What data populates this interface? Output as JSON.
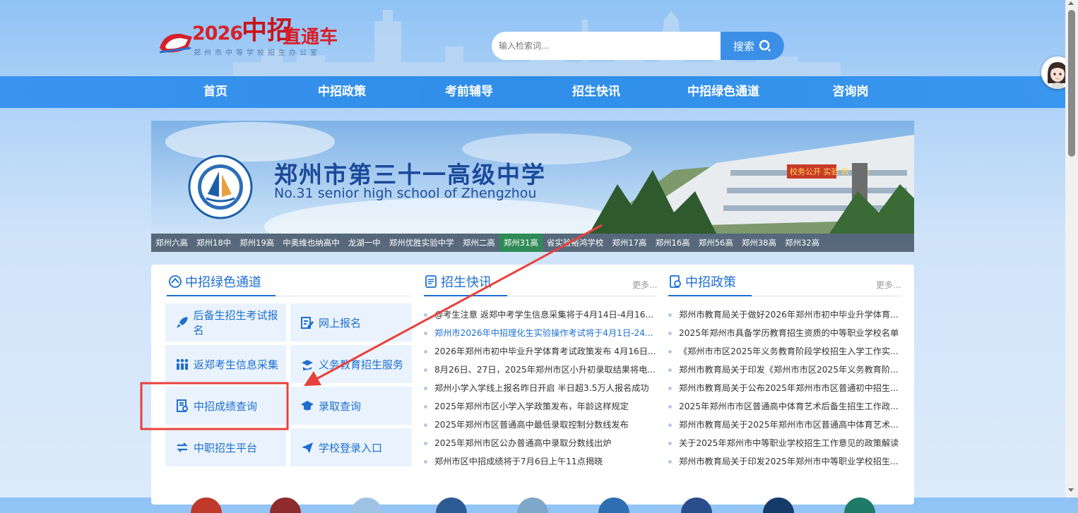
{
  "header": {
    "logo": {
      "year": "2026",
      "big": "中招",
      "title": "直通车",
      "sub": "郑州市中等学校招生办公室"
    },
    "search": {
      "placeholder": "输入检索词...",
      "button_label": "搜索"
    }
  },
  "nav": {
    "items": [
      {
        "label": "首页"
      },
      {
        "label": "中招政策"
      },
      {
        "label": "考前辅导"
      },
      {
        "label": "招生快讯"
      },
      {
        "label": "中招绿色通道"
      },
      {
        "label": "咨询岗"
      }
    ]
  },
  "banner": {
    "school_cn": "郑州市第三十一高级中学",
    "school_en": "No.31 senior high school of Zhengzhou",
    "building_sign": "校务公开 实验 教 致 远",
    "tabs": [
      "郑州六高",
      "郑州18中",
      "郑州19高",
      "中奥维也纳高中",
      "龙湖一中",
      "郑州优胜实验中学",
      "郑州二高",
      "郑州31高",
      "省实验裕鸿学校",
      "郑州17高",
      "郑州16高",
      "郑州56高",
      "郑州38高",
      "郑州32高"
    ],
    "active_tab": "郑州31高"
  },
  "green_channel": {
    "title": "中招绿色通道",
    "buttons": [
      {
        "label": "后备生招生考试报名",
        "icon": "rocket-icon"
      },
      {
        "label": "网上报名",
        "icon": "form-edit-icon"
      },
      {
        "label": "返郑考生信息采集",
        "icon": "people-icon"
      },
      {
        "label": "义务教育招生服务",
        "icon": "graduation-hand-icon"
      },
      {
        "label": "中招成绩查询",
        "icon": "score-search-icon"
      },
      {
        "label": "录取查询",
        "icon": "mortarboard-icon"
      },
      {
        "label": "中职招生平台",
        "icon": "platform-icon"
      },
      {
        "label": "学校登录入口",
        "icon": "paper-plane-icon"
      }
    ]
  },
  "news_flash": {
    "title": "招生快讯",
    "more": "更多...",
    "items": [
      "@考生注意 返郑中考学生信息采集将于4月14日-4月16...",
      "郑州市2026年中招理化生实验操作考试将于4月1日-24...",
      "2026年郑州市初中毕业升学体育考试政策发布 4月16日...",
      "8月26日、27日，2025年郑州市区小升初录取结果将电...",
      "郑州小学入学线上报名昨日开启 半日超3.5万人报名成功",
      "2025年郑州市区小学入学政策发布，年龄这样规定",
      "2025年郑州市区普通高中最低录取控制分数线发布",
      "2025年郑州市区公办普通高中录取分数线出炉",
      "郑州市区中招成绩将于7月6日上午11点揭晓"
    ],
    "highlighted_index": 1
  },
  "policy": {
    "title": "中招政策",
    "more": "更多...",
    "items": [
      "郑州市教育局关于做好2026年郑州市初中毕业升学体育...",
      "2025年郑州市具备学历教育招生资质的中等职业学校名单",
      "《郑州市市区2025年义务教育阶段学校招生入学工作实...",
      "郑州市教育局关于印发《郑州市市区2025年义务教育阶...",
      "郑州市教育局关于公布2025年郑州市市区普通初中招生...",
      "2025年郑州市市区普通高中体育艺术后备生招生工作政...",
      "郑州市教育局关于2025年郑州市市区普通高中体育艺术...",
      "关于2025年郑州市中等职业学校招生工作意见的政策解读",
      "郑州市教育局关于印发2025年郑州市中等职业学校招生..."
    ]
  },
  "colors": {
    "accent": "#1e6fd0",
    "nav": "#3a93ef",
    "annotation": "#e8413c",
    "active_tab": "#2f8a57"
  }
}
